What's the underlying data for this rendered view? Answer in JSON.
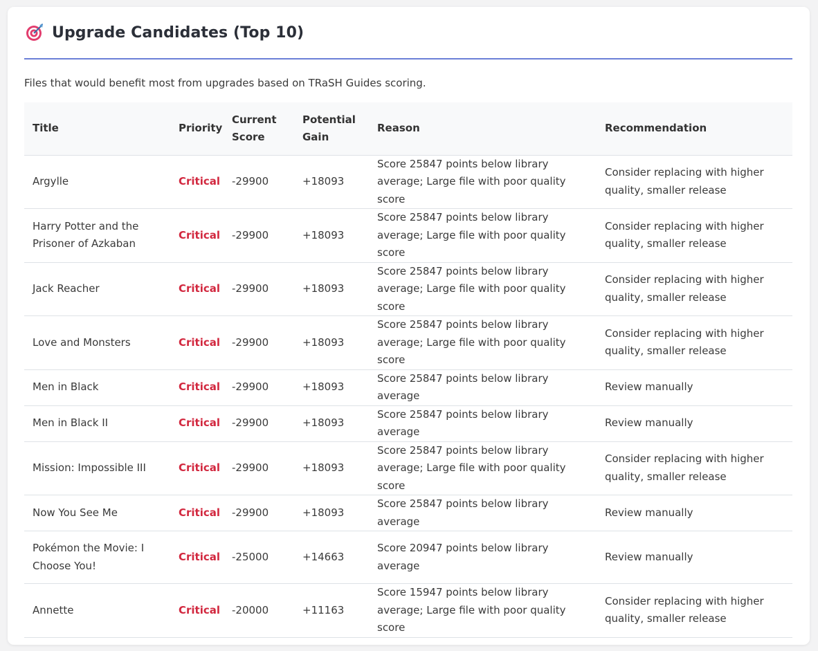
{
  "panel": {
    "title": "Upgrade Candidates (Top 10)",
    "icon": "target-icon",
    "description": "Files that would benefit most from upgrades based on TRaSH Guides scoring."
  },
  "colors": {
    "accent": "#6b7fd7",
    "critical": "#d2283f",
    "header_bg": "#f8f9fa"
  },
  "table": {
    "headers": {
      "title": "Title",
      "priority": "Priority",
      "current_score": "Current Score",
      "potential_gain": "Potential Gain",
      "reason": "Reason",
      "recommendation": "Recommendation"
    },
    "rows": [
      {
        "title": "Argylle",
        "priority": "Critical",
        "current_score": "-29900",
        "potential_gain": "+18093",
        "reason": "Score 25847 points below library average; Large file with poor quality score",
        "recommendation": "Consider replacing with higher quality, smaller release"
      },
      {
        "title": "Harry Potter and the Prisoner of Azkaban",
        "priority": "Critical",
        "current_score": "-29900",
        "potential_gain": "+18093",
        "reason": "Score 25847 points below library average; Large file with poor quality score",
        "recommendation": "Consider replacing with higher quality, smaller release"
      },
      {
        "title": "Jack Reacher",
        "priority": "Critical",
        "current_score": "-29900",
        "potential_gain": "+18093",
        "reason": "Score 25847 points below library average; Large file with poor quality score",
        "recommendation": "Consider replacing with higher quality, smaller release"
      },
      {
        "title": "Love and Monsters",
        "priority": "Critical",
        "current_score": "-29900",
        "potential_gain": "+18093",
        "reason": "Score 25847 points below library average; Large file with poor quality score",
        "recommendation": "Consider replacing with higher quality, smaller release"
      },
      {
        "title": "Men in Black",
        "priority": "Critical",
        "current_score": "-29900",
        "potential_gain": "+18093",
        "reason": "Score 25847 points below library average",
        "recommendation": "Review manually"
      },
      {
        "title": "Men in Black II",
        "priority": "Critical",
        "current_score": "-29900",
        "potential_gain": "+18093",
        "reason": "Score 25847 points below library average",
        "recommendation": "Review manually"
      },
      {
        "title": "Mission: Impossible III",
        "priority": "Critical",
        "current_score": "-29900",
        "potential_gain": "+18093",
        "reason": "Score 25847 points below library average; Large file with poor quality score",
        "recommendation": "Consider replacing with higher quality, smaller release"
      },
      {
        "title": "Now You See Me",
        "priority": "Critical",
        "current_score": "-29900",
        "potential_gain": "+18093",
        "reason": "Score 25847 points below library average",
        "recommendation": "Review manually"
      },
      {
        "title": "Pokémon the Movie: I Choose You!",
        "priority": "Critical",
        "current_score": "-25000",
        "potential_gain": "+14663",
        "reason": "Score 20947 points below library average",
        "recommendation": "Review manually"
      },
      {
        "title": "Annette",
        "priority": "Critical",
        "current_score": "-20000",
        "potential_gain": "+11163",
        "reason": "Score 15947 points below library average; Large file with poor quality score",
        "recommendation": "Consider replacing with higher quality, smaller release"
      }
    ]
  }
}
